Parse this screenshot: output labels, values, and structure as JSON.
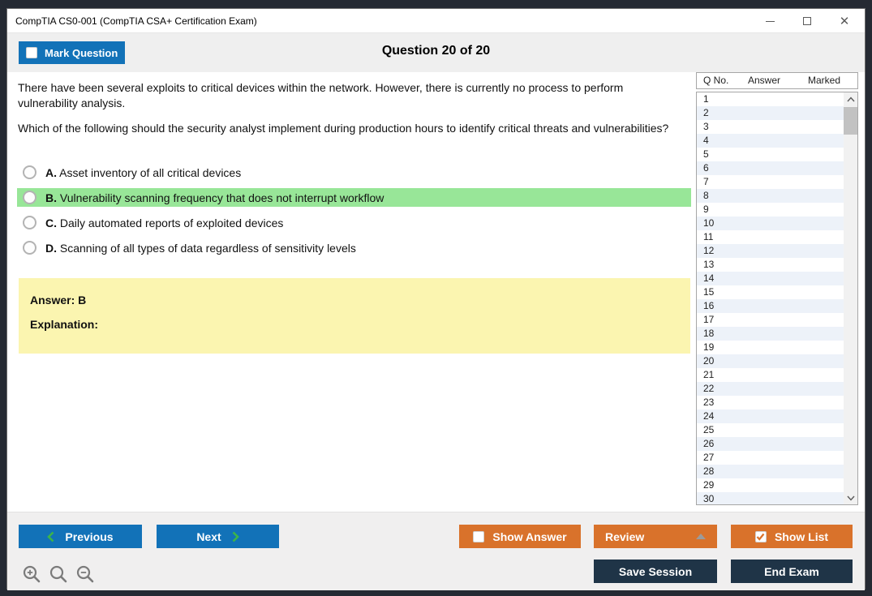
{
  "window": {
    "title": "CompTIA CS0-001 (CompTIA CSA+ Certification Exam)"
  },
  "icons": {
    "minimize": "minimize-icon",
    "maximize": "maximize-icon",
    "close": "close-icon",
    "close_glyph": "✕"
  },
  "header": {
    "mark_question_label": "Mark Question",
    "mark_question_checked": false,
    "question_counter": "Question 20 of 20"
  },
  "question": {
    "paragraphs": [
      "There have been several exploits to critical devices within the network. However, there is currently no process to perform vulnerability analysis.",
      "Which of the following should the security analyst implement during production hours to identify critical threats and vulnerabilities?"
    ],
    "options": [
      {
        "letter": "A.",
        "text": "Asset inventory of all critical devices",
        "highlighted": false
      },
      {
        "letter": "B.",
        "text": "Vulnerability scanning frequency that does not interrupt workflow",
        "highlighted": true
      },
      {
        "letter": "C.",
        "text": "Daily automated reports of exploited devices",
        "highlighted": false
      },
      {
        "letter": "D.",
        "text": "Scanning of all types of data regardless of sensitivity levels",
        "highlighted": false
      }
    ],
    "answer_label": "Answer: B",
    "explanation_label": "Explanation:"
  },
  "question_list": {
    "columns": [
      "Q No.",
      "Answer",
      "Marked"
    ],
    "rows": [
      {
        "q_no": "1",
        "answer": "",
        "marked": ""
      },
      {
        "q_no": "2",
        "answer": "",
        "marked": ""
      },
      {
        "q_no": "3",
        "answer": "",
        "marked": ""
      },
      {
        "q_no": "4",
        "answer": "",
        "marked": ""
      },
      {
        "q_no": "5",
        "answer": "",
        "marked": ""
      },
      {
        "q_no": "6",
        "answer": "",
        "marked": ""
      },
      {
        "q_no": "7",
        "answer": "",
        "marked": ""
      },
      {
        "q_no": "8",
        "answer": "",
        "marked": ""
      },
      {
        "q_no": "9",
        "answer": "",
        "marked": ""
      },
      {
        "q_no": "10",
        "answer": "",
        "marked": ""
      },
      {
        "q_no": "11",
        "answer": "",
        "marked": ""
      },
      {
        "q_no": "12",
        "answer": "",
        "marked": ""
      },
      {
        "q_no": "13",
        "answer": "",
        "marked": ""
      },
      {
        "q_no": "14",
        "answer": "",
        "marked": ""
      },
      {
        "q_no": "15",
        "answer": "",
        "marked": ""
      },
      {
        "q_no": "16",
        "answer": "",
        "marked": ""
      },
      {
        "q_no": "17",
        "answer": "",
        "marked": ""
      },
      {
        "q_no": "18",
        "answer": "",
        "marked": ""
      },
      {
        "q_no": "19",
        "answer": "",
        "marked": ""
      },
      {
        "q_no": "20",
        "answer": "",
        "marked": ""
      },
      {
        "q_no": "21",
        "answer": "",
        "marked": ""
      },
      {
        "q_no": "22",
        "answer": "",
        "marked": ""
      },
      {
        "q_no": "23",
        "answer": "",
        "marked": ""
      },
      {
        "q_no": "24",
        "answer": "",
        "marked": ""
      },
      {
        "q_no": "25",
        "answer": "",
        "marked": ""
      },
      {
        "q_no": "26",
        "answer": "",
        "marked": ""
      },
      {
        "q_no": "27",
        "answer": "",
        "marked": ""
      },
      {
        "q_no": "28",
        "answer": "",
        "marked": ""
      },
      {
        "q_no": "29",
        "answer": "",
        "marked": ""
      },
      {
        "q_no": "30",
        "answer": "",
        "marked": ""
      }
    ]
  },
  "footer": {
    "previous_label": "Previous",
    "next_label": "Next",
    "show_answer_label": "Show Answer",
    "show_answer_checked": false,
    "review_label": "Review",
    "show_list_label": "Show List",
    "show_list_checked": true,
    "save_session_label": "Save Session",
    "end_exam_label": "End Exam"
  },
  "colors": {
    "blue": "#1272B8",
    "orange": "#D9722B",
    "navy": "#1F3447",
    "green": "#98E698",
    "yellow": "#FBF5B0",
    "rowalt": "#EDF2F9",
    "chevron_green": "#3CB44A"
  }
}
